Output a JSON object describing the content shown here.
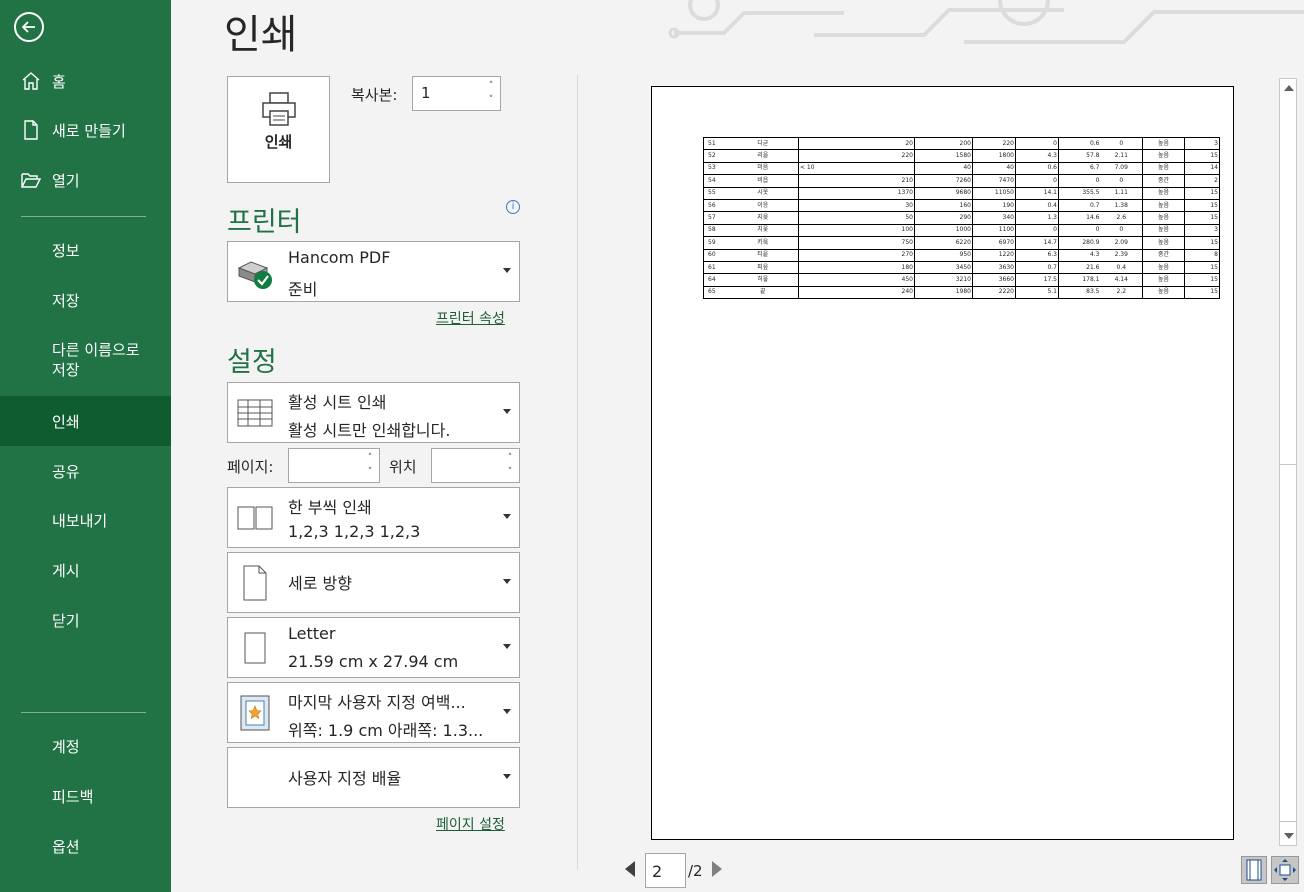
{
  "nav": {
    "home": "홈",
    "new": "새로 만들기",
    "open": "열기",
    "info": "정보",
    "save": "저장",
    "save_as_line1": "다른 이름으로",
    "save_as_line2": "저장",
    "print": "인쇄",
    "share": "공유",
    "export": "내보내기",
    "publish": "게시",
    "close": "닫기",
    "account": "계정",
    "feedback": "피드백",
    "options": "옵션"
  },
  "main": {
    "title": "인쇄",
    "print_button_label": "인쇄",
    "copies_label": "복사본:",
    "copies_value": "1",
    "printer_heading": "프린터",
    "printer_name": "Hancom PDF",
    "printer_status": "준비",
    "printer_props_link": "프린터 속성",
    "settings_heading": "설정",
    "print_what_line1": "활성 시트 인쇄",
    "print_what_line2": "활성 시트만 인쇄합니다.",
    "pages_label": "페이지:",
    "pages_from_value": "",
    "pages_to_label": "위치",
    "pages_to_value": "",
    "collate_line1": "한 부씩 인쇄",
    "collate_line2": "1,2,3     1,2,3     1,2,3",
    "orientation": "세로 방향",
    "paper_line1": "Letter",
    "paper_line2": "21.59 cm x 27.94 cm",
    "margins_line1": "마지막 사용자 지정 여백...",
    "margins_line2": "위쪽: 1.9 cm 아래쪽: 1.3...",
    "scaling": "사용자 지정 배율",
    "page_setup_link": "페이지 설정",
    "current_page": "2",
    "total_pages": "/2"
  },
  "preview_table": [
    [
      "51",
      "디귿",
      "",
      "20",
      "200",
      "220",
      "0",
      "0.6",
      "0",
      "높음",
      "3"
    ],
    [
      "52",
      "리을",
      "",
      "220",
      "1580",
      "1800",
      "4.3",
      "57.8",
      "2.11",
      "높음",
      "15"
    ],
    [
      "53",
      "미음",
      "< 10",
      "",
      "40",
      "40",
      "0.6",
      "6.7",
      "7.09",
      "높음",
      "14"
    ],
    [
      "54",
      "비읍",
      "",
      "210",
      "7260",
      "7470",
      "0",
      "0",
      "0",
      "중간",
      "2"
    ],
    [
      "55",
      "시옷",
      "",
      "1370",
      "9680",
      "11050",
      "14.1",
      "355.5",
      "1.11",
      "높음",
      "15"
    ],
    [
      "56",
      "이응",
      "",
      "30",
      "160",
      "190",
      "0.4",
      "0.7",
      "1.38",
      "높음",
      "15"
    ],
    [
      "57",
      "지읒",
      "",
      "50",
      "290",
      "340",
      "1.3",
      "14.6",
      "2.6",
      "높음",
      "15"
    ],
    [
      "58",
      "치읓",
      "",
      "100",
      "1000",
      "1100",
      "0",
      "0",
      "0",
      "높음",
      "3"
    ],
    [
      "59",
      "키읔",
      "",
      "750",
      "6220",
      "6970",
      "14.7",
      "280.9",
      "2.09",
      "높음",
      "15"
    ],
    [
      "60",
      "티읕",
      "",
      "270",
      "950",
      "1220",
      "6.3",
      "4.3",
      "2.39",
      "중간",
      "8"
    ],
    [
      "61",
      "피읖",
      "",
      "180",
      "3450",
      "3630",
      "0.7",
      "21.6",
      "0.4",
      "높음",
      "15"
    ],
    [
      "64",
      "히읗",
      "",
      "450",
      "3210",
      "3660",
      "17.5",
      "178.1",
      "4.14",
      "높음",
      "15"
    ],
    [
      "65",
      "끝",
      "",
      "240",
      "1980",
      "2220",
      "5.1",
      "83.5",
      "2.2",
      "높음",
      "15"
    ]
  ],
  "colors": {
    "sidebar": "#217346",
    "sidebar_active": "#0e5c2f",
    "accent_text": "#217346"
  }
}
